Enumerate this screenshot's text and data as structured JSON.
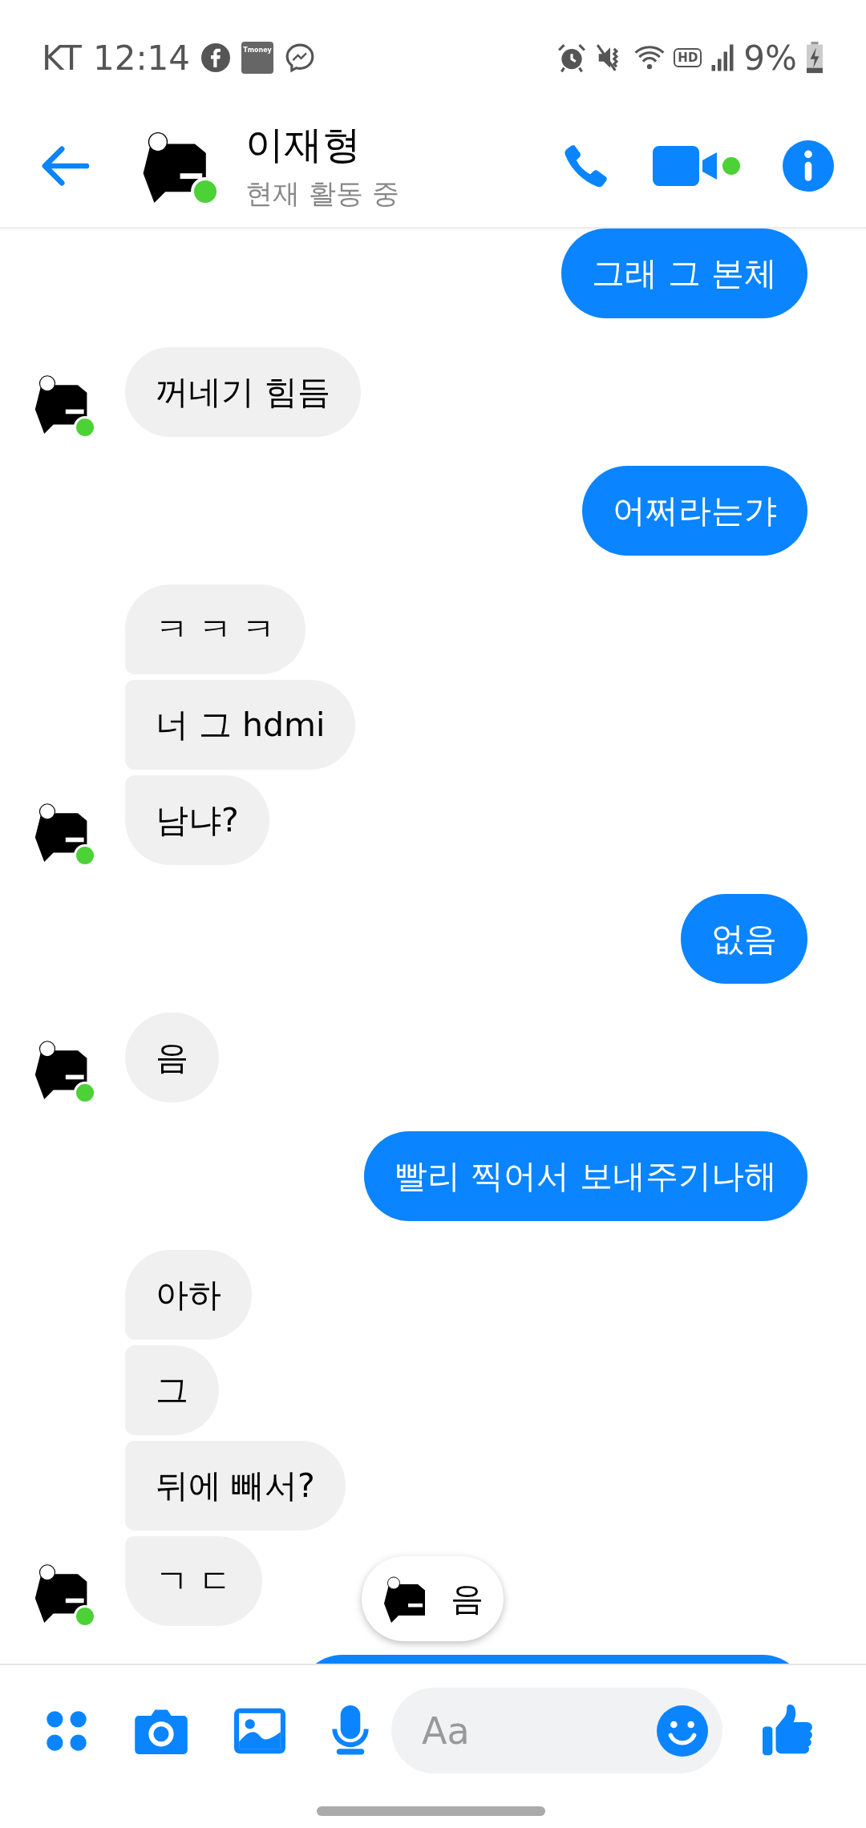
{
  "status_bar": {
    "carrier": "KT",
    "time": "12:14",
    "tmoney_label": "Tmoney",
    "hd_label": "HD",
    "battery": "9%"
  },
  "header": {
    "name": "이재형",
    "status": "현재 활동 중",
    "active": true
  },
  "messages": [
    {
      "kind": "sent",
      "text": "그래 그 본체"
    },
    {
      "kind": "received",
      "text": "꺼네기 힘듬",
      "avatar": true
    },
    {
      "kind": "sent",
      "text": "어쩌라는갸"
    },
    {
      "kind": "received",
      "text": "ㅋ ㅋ ㅋ",
      "avatar": false
    },
    {
      "kind": "received",
      "text": "너 그 hdmi",
      "avatar": false
    },
    {
      "kind": "received",
      "text": "남냐?",
      "avatar": true
    },
    {
      "kind": "sent",
      "text": "없음"
    },
    {
      "kind": "received",
      "text": "음",
      "avatar": true
    },
    {
      "kind": "sent",
      "text": "빨리 찍어서 보내주기나해"
    },
    {
      "kind": "received",
      "text": "아하",
      "avatar": false
    },
    {
      "kind": "received",
      "text": "그",
      "avatar": false
    },
    {
      "kind": "received",
      "text": "뒤에 빼서?",
      "avatar": false
    },
    {
      "kind": "received",
      "text": "ㄱ ㄷ",
      "avatar": true
    },
    {
      "kind": "sent"
    }
  ],
  "new_message_pill": {
    "text": "음"
  },
  "composer": {
    "placeholder": "Aa"
  }
}
